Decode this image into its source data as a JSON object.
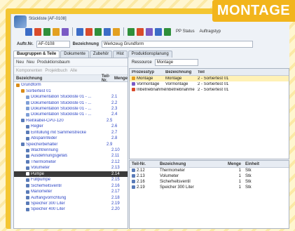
{
  "badge": "MONTAGE",
  "window": {
    "title": "Stückliste [AF-0108]"
  },
  "toolbar": {
    "icons": [
      "open-icon",
      "save-icon",
      "print-icon",
      "copy-icon",
      "paste-icon",
      "link-icon",
      "add-icon",
      "chart-icon",
      "tools-icon",
      "grid-icon",
      "user-icon",
      "calendar-icon",
      "settings-icon",
      "list-icon",
      "help-icon"
    ],
    "icon_colors": [
      "#3b6cc6",
      "#d94b2b",
      "#2f8f3a",
      "#e3a020",
      "#7b5bc4",
      "#3b6cc6",
      "#d94b2b",
      "#2f8f3a",
      "#3b6cc6",
      "#e3a020",
      "#2f8f3a",
      "#d94b2b",
      "#7b5bc4",
      "#3b6cc6",
      "#2f8f3a"
    ],
    "menu_status": "PP Status",
    "menu_auftrag": "Auftragstyp"
  },
  "auftrag": {
    "label": "Auftr.Nr.",
    "value": "AF-0108",
    "bez_label": "Bezeichnung",
    "bez_value": "Werkzeug Grundform"
  },
  "tabs": [
    "Baugruppen & Teile",
    "Dokumente",
    "Zubehör",
    "Hist",
    "Produktionsplanung"
  ],
  "left": {
    "toolbar1": [
      "Neu",
      "Neu",
      "Produktionsbaum"
    ],
    "toolbar2": [
      "Komponenten",
      "Projektbuch",
      "Alle"
    ],
    "col_name": "Bezeichnung",
    "col_num": "Teil-Nr.",
    "col_menge": "Menge",
    "rows": [
      {
        "name": "Grundform",
        "num": "",
        "indent": 0,
        "color": "#d98c1a"
      },
      {
        "name": "Sortiertest 01",
        "num": "",
        "indent": 1,
        "color": "#d98c1a"
      },
      {
        "name": "Dokumentation Stückliste 01 - ...",
        "num": "2.1",
        "indent": 2,
        "color": "#7f9fd8"
      },
      {
        "name": "Dokumentation Stückliste 01 - ...",
        "num": "2.2",
        "indent": 2,
        "color": "#7f9fd8"
      },
      {
        "name": "Dokumentation Stückliste 01 - ...",
        "num": "2.3",
        "indent": 2,
        "color": "#7f9fd8"
      },
      {
        "name": "Dokumentation Stückliste 01 - ...",
        "num": "2.4",
        "indent": 2,
        "color": "#7f9fd8"
      },
      {
        "name": "Reißkabel-CPU-120",
        "num": "2.5",
        "indent": 1,
        "color": "#5a7bb8"
      },
      {
        "name": "Regler",
        "num": "2.6",
        "indent": 2,
        "color": "#5a7bb8"
      },
      {
        "name": "Einfüllung mit Sammelstrecke",
        "num": "2.7",
        "indent": 2,
        "color": "#5a7bb8"
      },
      {
        "name": "Abspannfeder",
        "num": "2.8",
        "indent": 2,
        "color": "#5a7bb8"
      },
      {
        "name": "Speicherbehälter",
        "num": "2.9",
        "indent": 1,
        "color": "#5a7bb8"
      },
      {
        "name": "Wachtrennung",
        "num": "2.10",
        "indent": 2,
        "color": "#5a7bb8"
      },
      {
        "name": "Ausdehnungsgefäß",
        "num": "2.11",
        "indent": 2,
        "color": "#5a7bb8"
      },
      {
        "name": "Thermometer",
        "num": "2.12",
        "indent": 2,
        "color": "#5a7bb8"
      },
      {
        "name": "Volumeter",
        "num": "2.13",
        "indent": 2,
        "color": "#5a7bb8"
      },
      {
        "name": "Pumpe",
        "num": "2.14",
        "indent": 2,
        "color": "#ffffff"
      },
      {
        "name": "Füllpumpe",
        "num": "2.15",
        "indent": 2,
        "color": "#5a7bb8"
      },
      {
        "name": "Sicherheitsventil",
        "num": "2.16",
        "indent": 2,
        "color": "#5a7bb8"
      },
      {
        "name": "Manometer",
        "num": "2.17",
        "indent": 2,
        "color": "#5a7bb8"
      },
      {
        "name": "Auffangvorrichtung",
        "num": "2.18",
        "indent": 2,
        "color": "#5a7bb8"
      },
      {
        "name": "Speicher 300 Liter",
        "num": "2.19",
        "indent": 2,
        "color": "#5a7bb8"
      },
      {
        "name": "Speicher 400 Liter",
        "num": "2.20",
        "indent": 2,
        "color": "#5a7bb8"
      }
    ],
    "selected_index": 15
  },
  "resource": {
    "label": "Ressource",
    "value": "Montage"
  },
  "process": {
    "cols": [
      "Prozesstyp",
      "Bezeichnung",
      "Teil"
    ],
    "rows": [
      {
        "typ": "Montage",
        "bez": "Montage",
        "teil": "2 - Sortiertest 01",
        "color": "#e3a020"
      },
      {
        "typ": "Vormontage",
        "bez": "Vormontage",
        "teil": "2 - Sortiertest 01",
        "color": "#7b5bc4"
      },
      {
        "typ": "Inbetriebnahme",
        "bez": "Inbetriebnahme",
        "teil": "2 - Sortiertest 01",
        "color": "#d94b2b"
      }
    ]
  },
  "parts": {
    "cols": [
      "Teil-Nr.",
      "Bezeichnung",
      "Menge",
      "Einheit"
    ],
    "rows": [
      {
        "nr": "2.12",
        "bez": "Thermometer",
        "menge": "1",
        "einheit": "Stk"
      },
      {
        "nr": "2.13",
        "bez": "Volumeter",
        "menge": "1",
        "einheit": "Stk"
      },
      {
        "nr": "2.16",
        "bez": "Sicherheitsventil",
        "menge": "1",
        "einheit": "Stk"
      },
      {
        "nr": "2.19",
        "bez": "Speicher 300 Liter",
        "menge": "1",
        "einheit": "Stk"
      }
    ]
  }
}
